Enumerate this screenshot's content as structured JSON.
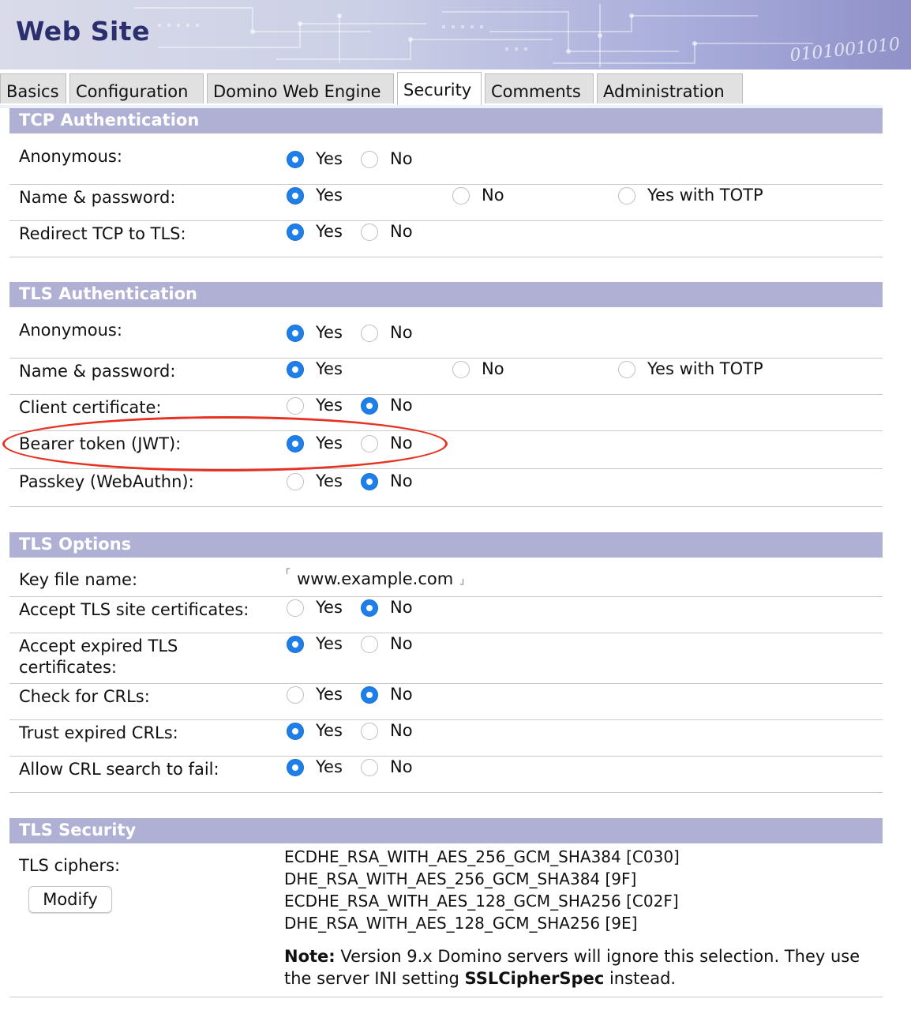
{
  "banner": {
    "title": "Web Site",
    "decor_digits": "0101001010"
  },
  "tabs": [
    "Basics",
    "Configuration",
    "Domino Web Engine",
    "Security",
    "Comments",
    "Administration"
  ],
  "active_tab": "Security",
  "yes": "Yes",
  "no": "No",
  "yes_totp": "Yes with TOTP",
  "sections": {
    "tcp": {
      "header": "TCP Authentication",
      "rows": [
        {
          "label": "Anonymous:",
          "value": "Yes"
        },
        {
          "label": "Name & password:",
          "value": "Yes"
        },
        {
          "label": "Redirect TCP to TLS:",
          "value": "Yes"
        }
      ]
    },
    "tls_auth": {
      "header": "TLS Authentication",
      "rows": [
        {
          "label": "Anonymous:",
          "value": "Yes"
        },
        {
          "label": "Name & password:",
          "value": "Yes"
        },
        {
          "label": "Client certificate:",
          "value": "No"
        },
        {
          "label": "Bearer token (JWT):",
          "value": "Yes"
        },
        {
          "label": "Passkey (WebAuthn):",
          "value": "No"
        }
      ]
    },
    "tls_options": {
      "header": "TLS Options",
      "key_file_label": "Key file name:",
      "key_file_value": "www.example.com",
      "rows": [
        {
          "label": "Accept TLS site certificates:",
          "value": "No"
        },
        {
          "label": "Accept expired TLS",
          "label2": "certificates:",
          "value": "Yes"
        },
        {
          "label": "Check for CRLs:",
          "value": "No"
        },
        {
          "label": "Trust expired CRLs:",
          "value": "Yes"
        },
        {
          "label": "Allow CRL search to fail:",
          "value": "Yes"
        }
      ]
    },
    "tls_security": {
      "header": "TLS Security",
      "ciphers_label": "TLS ciphers:",
      "modify_label": "Modify",
      "ciphers": [
        "ECDHE_RSA_WITH_AES_256_GCM_SHA384 [C030]",
        "DHE_RSA_WITH_AES_256_GCM_SHA384 [9F]",
        "ECDHE_RSA_WITH_AES_128_GCM_SHA256 [C02F]",
        "DHE_RSA_WITH_AES_128_GCM_SHA256 [9E]"
      ],
      "note_prefix": "Note:",
      "note_text1": " Version 9.x Domino servers will ignore this selection. They use the server INI setting ",
      "note_keyword": "SSLCipherSpec",
      "note_text2": " instead."
    }
  },
  "colors": {
    "section_header_bg": "#b0b0d5",
    "radio_selected": "#1f7fe9",
    "highlight_ellipse": "#e53222",
    "banner_title": "#2c2f6e"
  }
}
